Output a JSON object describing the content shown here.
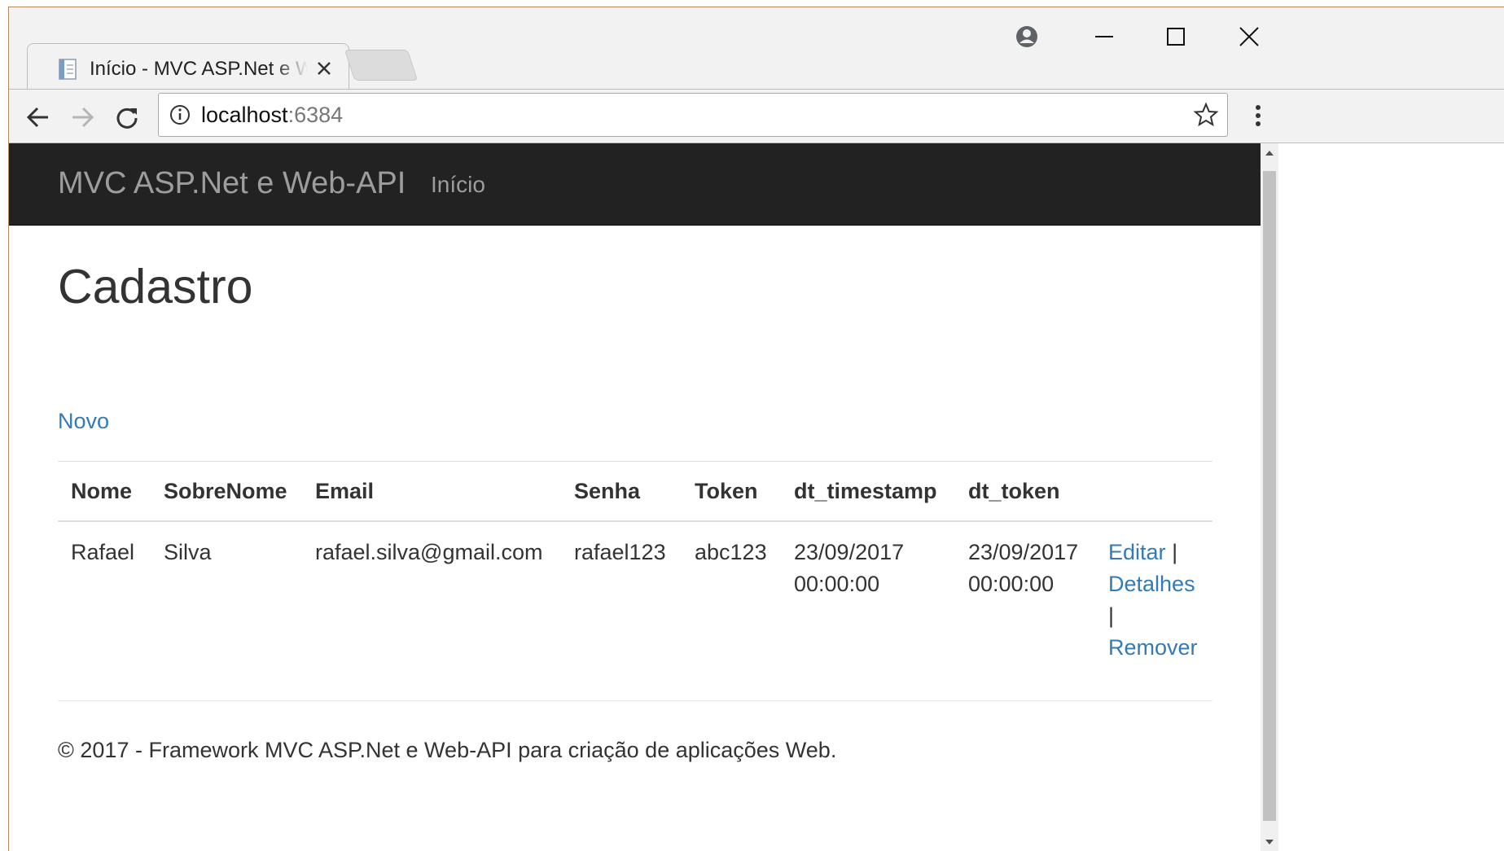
{
  "browser": {
    "tab_title": "Início - MVC ASP.Net e W",
    "url_host": "localhost",
    "url_port": ":6384",
    "icons": [
      "page-icon",
      "close-icon",
      "account-icon",
      "minimize-icon",
      "maximize-icon",
      "window-close-icon",
      "back-icon",
      "forward-icon",
      "reload-icon",
      "info-icon",
      "star-icon",
      "menu-icon"
    ]
  },
  "navbar": {
    "brand": "MVC ASP.Net e Web-API",
    "links": [
      "Início"
    ]
  },
  "page": {
    "title": "Cadastro",
    "new_link": "Novo"
  },
  "table": {
    "headers": [
      "Nome",
      "SobreNome",
      "Email",
      "Senha",
      "Token",
      "dt_timestamp",
      "dt_token",
      ""
    ],
    "rows": [
      {
        "nome": "Rafael",
        "sobrenome": "Silva",
        "email": "rafael.silva@gmail.com",
        "senha": "rafael123",
        "token": "abc123",
        "dt_timestamp_date": "23/09/2017",
        "dt_timestamp_time": "00:00:00",
        "dt_token_date": "23/09/2017",
        "dt_token_time": "00:00:00",
        "actions": {
          "edit": "Editar",
          "details": "Detalhes",
          "remove": "Remover",
          "separator": "|"
        }
      }
    ]
  },
  "footer": {
    "text": "© 2017 - Framework MVC ASP.Net e Web-API para criação de aplicações Web."
  }
}
